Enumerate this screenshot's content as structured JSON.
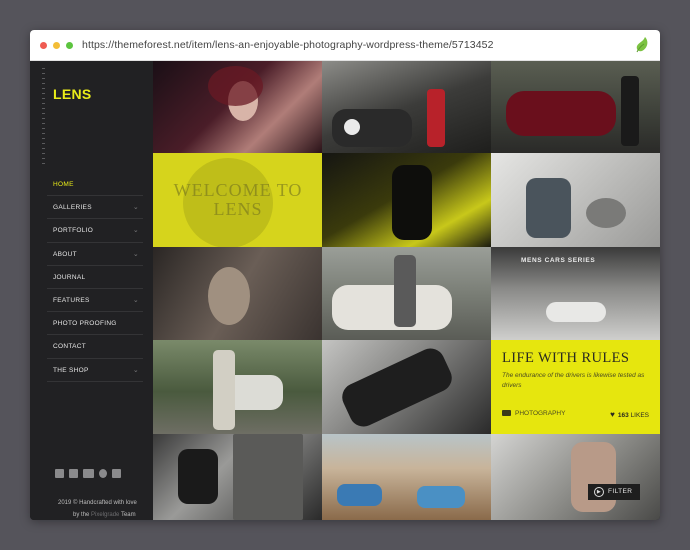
{
  "browser": {
    "url": "https://themeforest.net/item/lens-an-enjoyable-photography-wordpress-theme/5713452"
  },
  "sidebar": {
    "logo": "LENS",
    "menu": [
      {
        "label": "HOME",
        "active": true,
        "has_submenu": false
      },
      {
        "label": "GALLERIES",
        "active": false,
        "has_submenu": true
      },
      {
        "label": "PORTFOLIO",
        "active": false,
        "has_submenu": true
      },
      {
        "label": "ABOUT",
        "active": false,
        "has_submenu": true
      },
      {
        "label": "JOURNAL",
        "active": false,
        "has_submenu": false
      },
      {
        "label": "FEATURES",
        "active": false,
        "has_submenu": true
      },
      {
        "label": "PHOTO PROOFING",
        "active": false,
        "has_submenu": false
      },
      {
        "label": "CONTACT",
        "active": false,
        "has_submenu": false
      },
      {
        "label": "THE SHOP",
        "active": false,
        "has_submenu": true
      }
    ],
    "social_icons": [
      "twitter-icon",
      "facebook-icon",
      "behance-icon",
      "skype-icon",
      "flickr-icon"
    ],
    "footer_line1": "2019 © Handcrafted with love",
    "footer_line2_prefix": "by the",
    "footer_brand": "Pixelgrade",
    "footer_line2_suffix": "Team"
  },
  "welcome_tile": {
    "line1": "WELCOME TO",
    "line2": "LENS"
  },
  "cars_tile": {
    "label": "MENS CARS SERIES"
  },
  "feature_tile": {
    "title": "LIFE WITH RULES",
    "description": "The endurance of the drivers is likewise tested as drivers",
    "category": "PHOTOGRAPHY",
    "likes_count": "163",
    "likes_label": "LIKES"
  },
  "filter_button": {
    "label": "FILTER"
  },
  "colors": {
    "accent": "#e9ec19",
    "sidebar_bg": "#212123",
    "page_bg": "#55545b"
  }
}
